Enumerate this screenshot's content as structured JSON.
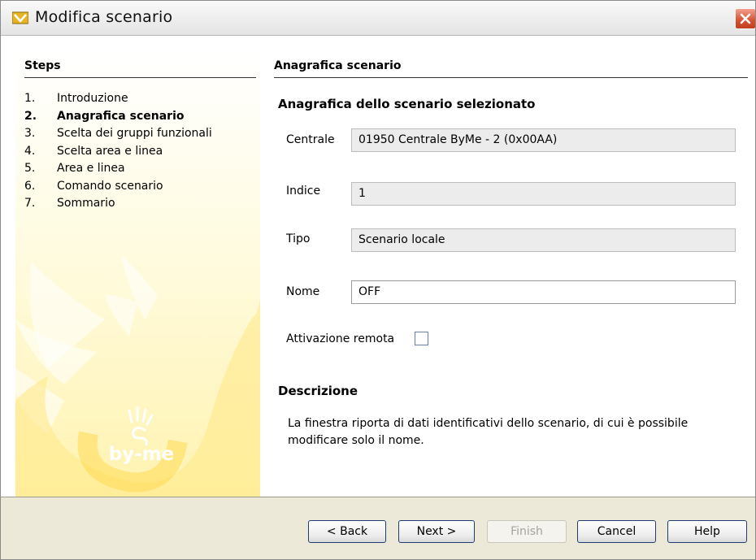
{
  "window": {
    "title": "Modifica scenario"
  },
  "steps": {
    "title": "Steps",
    "items": [
      {
        "num": "1.",
        "label": "Introduzione",
        "active": false
      },
      {
        "num": "2.",
        "label": "Anagrafica scenario",
        "active": true
      },
      {
        "num": "3.",
        "label": "Scelta dei gruppi funzionali",
        "active": false
      },
      {
        "num": "4.",
        "label": "Scelta area e linea",
        "active": false
      },
      {
        "num": "5.",
        "label": "Area e linea",
        "active": false
      },
      {
        "num": "6.",
        "label": "Comando scenario",
        "active": false
      },
      {
        "num": "7.",
        "label": "Sommario",
        "active": false
      }
    ]
  },
  "logo": {
    "text": "by-me"
  },
  "main": {
    "section_title": "Anagrafica scenario",
    "group_title": "Anagrafica dello scenario selezionato",
    "fields": {
      "centrale": {
        "label": "Centrale",
        "value": "01950 Centrale ByMe - 2 (0x00AA)"
      },
      "indice": {
        "label": "Indice",
        "value": "1"
      },
      "tipo": {
        "label": "Tipo",
        "value": "Scenario locale"
      },
      "nome": {
        "label": "Nome",
        "value": "OFF"
      }
    },
    "remote": {
      "label": "Attivazione remota",
      "checked": false
    },
    "description": {
      "title": "Descrizione",
      "text": "La finestra riporta di dati identificativi dello scenario, di cui è possibile modificare solo il nome."
    }
  },
  "buttons": {
    "back": "< Back",
    "next": "Next >",
    "finish": "Finish",
    "cancel": "Cancel",
    "help": "Help"
  },
  "colors": {
    "panel_yellow": "#fff3b0",
    "close_red": "#d5502f",
    "button_border": "#1f3c73"
  }
}
